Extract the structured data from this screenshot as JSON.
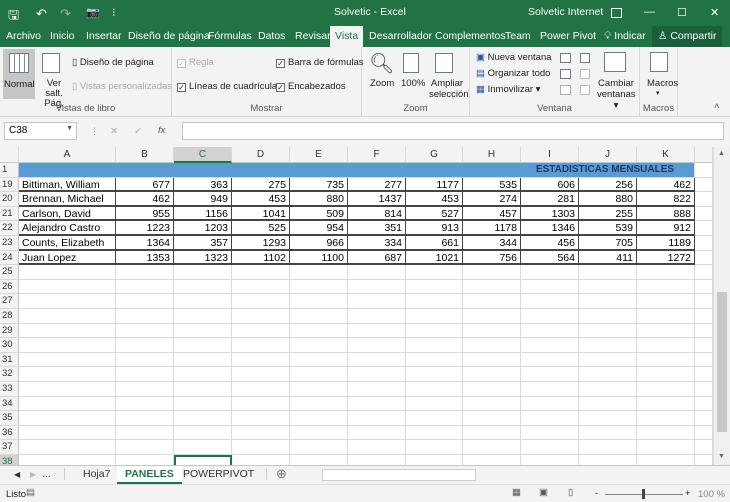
{
  "title_bar": {
    "title": "Solvetic  -  Excel",
    "account": "Solvetic Internet",
    "minimize": "—",
    "maximize": "☐",
    "close": "✕"
  },
  "qat": {
    "save": "🖫",
    "undo": "↶",
    "redo": "↷",
    "camera": "📷",
    "more": "⁝"
  },
  "tabs": [
    "Archivo",
    "Inicio",
    "Insertar",
    "Diseño de página",
    "Fórmulas",
    "Datos",
    "Revisar",
    "Vista",
    "Desarrollador",
    "Complementos",
    "Team",
    "Power Pivot"
  ],
  "active_tab": "Vista",
  "tell_me": "Indicar",
  "share": "Compartir",
  "ribbon": {
    "vistas_libro": {
      "label": "Vistas de libro",
      "normal": "Normal",
      "ver_salt": "Ver salt. Pág.",
      "diseno": "Diseño de página",
      "personalizadas": "Vistas personalizadas"
    },
    "mostrar": {
      "label": "Mostrar",
      "regla": "Regla",
      "lineas": "Líneas de cuadrícula",
      "barra": "Barra de fórmulas",
      "encabezados": "Encabezados"
    },
    "zoom": {
      "label": "Zoom",
      "zoom": "Zoom",
      "cien": "100%",
      "ampliar": "Ampliar selección"
    },
    "ventana": {
      "label": "Ventana",
      "nueva": "Nueva ventana",
      "organizar": "Organizar todo",
      "inmovilizar": "Inmovilizar",
      "cambiar": "Cambiar ventanas"
    },
    "macros": {
      "label": "Macros",
      "macros": "Macros"
    }
  },
  "formula_bar": {
    "name_box": "C38",
    "cancel": "✕",
    "enter": "✓",
    "fx": "fx",
    "formula": ""
  },
  "columns": [
    "A",
    "B",
    "C",
    "D",
    "E",
    "F",
    "G",
    "H",
    "I",
    "J",
    "K"
  ],
  "header_row": {
    "number": "1",
    "title": "ESTADISTICAS MENSUALES"
  },
  "rows": [
    {
      "n": "19",
      "name": "Bittiman, William",
      "v": [
        "677",
        "363",
        "275",
        "735",
        "277",
        "1177",
        "535",
        "606",
        "256",
        "462"
      ]
    },
    {
      "n": "20",
      "name": "Brennan, Michael",
      "v": [
        "462",
        "949",
        "453",
        "880",
        "1437",
        "453",
        "274",
        "281",
        "880",
        "822"
      ]
    },
    {
      "n": "21",
      "name": "Carlson, David",
      "v": [
        "955",
        "1156",
        "1041",
        "509",
        "814",
        "527",
        "457",
        "1303",
        "255",
        "888"
      ]
    },
    {
      "n": "22",
      "name": "Alejandro Castro",
      "v": [
        "1223",
        "1203",
        "525",
        "954",
        "351",
        "913",
        "1178",
        "1346",
        "539",
        "912"
      ]
    },
    {
      "n": "23",
      "name": "Counts, Elizabeth",
      "v": [
        "1364",
        "357",
        "1293",
        "966",
        "334",
        "661",
        "344",
        "456",
        "705",
        "1189"
      ]
    },
    {
      "n": "24",
      "name": "Juan Lopez",
      "v": [
        "1353",
        "1323",
        "1102",
        "1100",
        "687",
        "1021",
        "756",
        "564",
        "411",
        "1272"
      ]
    }
  ],
  "empty_rows": [
    "25",
    "26",
    "27",
    "28",
    "29",
    "30",
    "31",
    "32",
    "33",
    "34",
    "35",
    "36",
    "37",
    "38"
  ],
  "selected_cell": "C38",
  "sheet_tabs": {
    "ellipsis": "...",
    "tabs": [
      "Hoja7",
      "PANELES",
      "POWERPIVOT"
    ],
    "active": "PANELES",
    "add": "⊕"
  },
  "status": {
    "ready": "Listo",
    "zoom": "100 %",
    "minus": "-",
    "plus": "+"
  },
  "colors": {
    "excel_green": "#217346",
    "header_fill": "#5b9bd5",
    "header_text": "#1f3864"
  }
}
